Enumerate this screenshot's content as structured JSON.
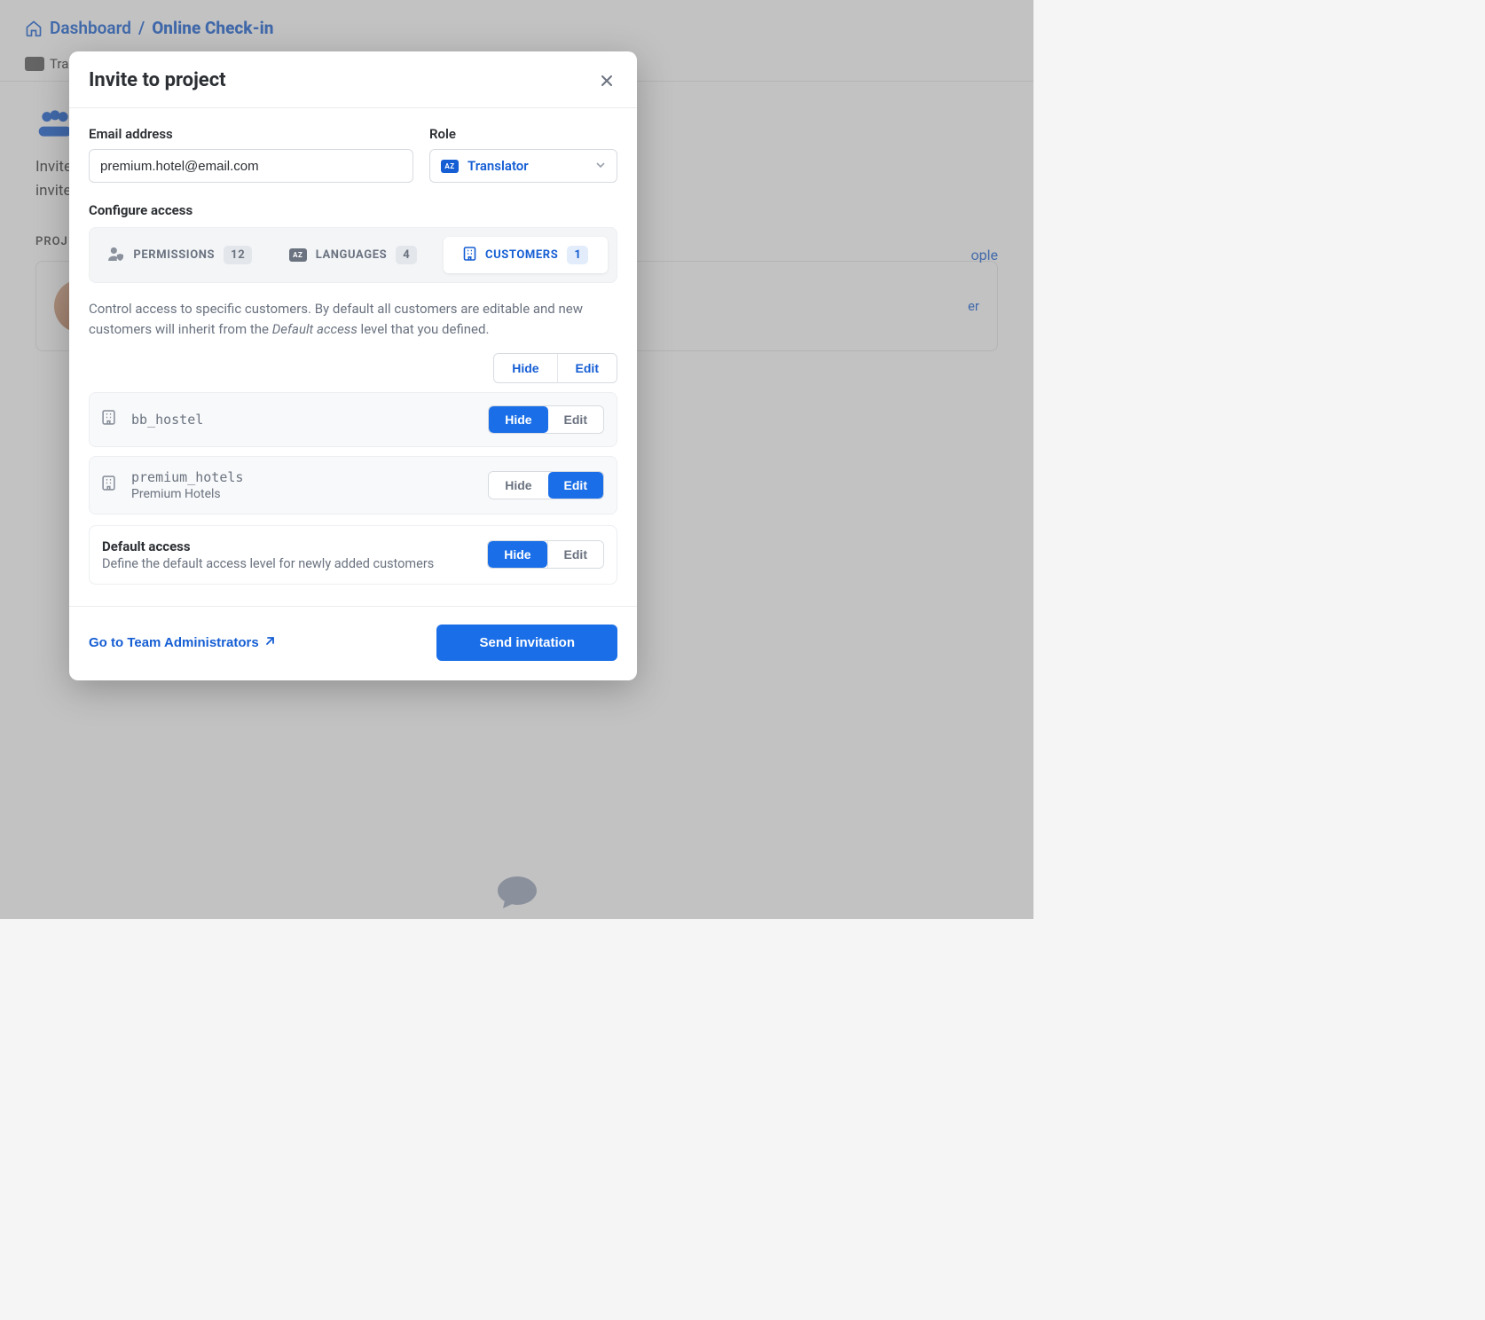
{
  "breadcrumb": {
    "dashboard": "Dashboard",
    "separator": "/",
    "project": "Online Check-in"
  },
  "bg": {
    "tab_label": "Trans",
    "invite_line": "Invite",
    "invite_line2": "invite",
    "proj_label": "PROJ",
    "add_people": "ople",
    "role_suffix": "er"
  },
  "modal": {
    "title": "Invite to project",
    "email_label": "Email address",
    "email_value": "premium.hotel@email.com",
    "role_label": "Role",
    "role_value": "Translator",
    "configure_label": "Configure access",
    "tabs": {
      "permissions": {
        "label": "PERMISSIONS",
        "count": "12"
      },
      "languages": {
        "label": "LANGUAGES",
        "count": "4"
      },
      "customers": {
        "label": "CUSTOMERS",
        "count": "1"
      }
    },
    "desc_prefix": "Control access to specific customers. By default all customers are editable and new customers will inherit from the ",
    "desc_em": "Default access",
    "desc_suffix": " level that you defined.",
    "header_toggle": {
      "hide": "Hide",
      "edit": "Edit"
    },
    "customers": [
      {
        "code": "bb_hostel",
        "name": "",
        "state": "hide"
      },
      {
        "code": "premium_hotels",
        "name": "Premium Hotels",
        "state": "edit"
      }
    ],
    "default": {
      "title": "Default access",
      "subtitle": "Define the default access level for newly added customers",
      "state": "hide"
    },
    "toggles": {
      "hide": "Hide",
      "edit": "Edit"
    },
    "footer": {
      "admins_link": "Go to Team Administrators",
      "send": "Send invitation"
    }
  }
}
